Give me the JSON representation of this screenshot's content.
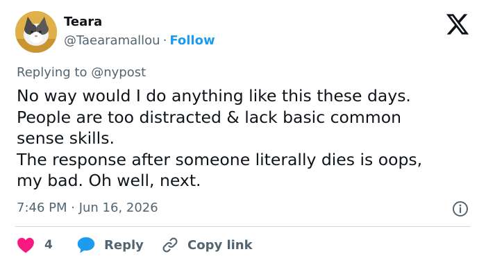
{
  "author": {
    "display_name": "Teara",
    "handle": "@Taearamallou",
    "separator": "·",
    "follow_label": "Follow"
  },
  "reply_context": {
    "prefix": "Replying to",
    "mention": "@nypost"
  },
  "tweet": {
    "lines": [
      "No way would I do anything like this these days.",
      "People are too distracted & lack basic common",
      "sense skills.",
      "The response after someone literally dies is oops,",
      "my bad. Oh well, next."
    ],
    "timestamp": "7:46 PM · Jun 16, 2026"
  },
  "actions": {
    "like_count": "4",
    "reply_label": "Reply",
    "copy_label": "Copy link"
  },
  "icons": {
    "brand": "x-logo-icon",
    "info": "info-icon",
    "like": "heart-icon",
    "reply": "speech-bubble-icon",
    "copy": "link-icon"
  },
  "colors": {
    "text": "#0f1419",
    "secondary": "#536471",
    "accent": "#1d9bf0",
    "like": "#f91880",
    "divider": "#cfd9de"
  }
}
